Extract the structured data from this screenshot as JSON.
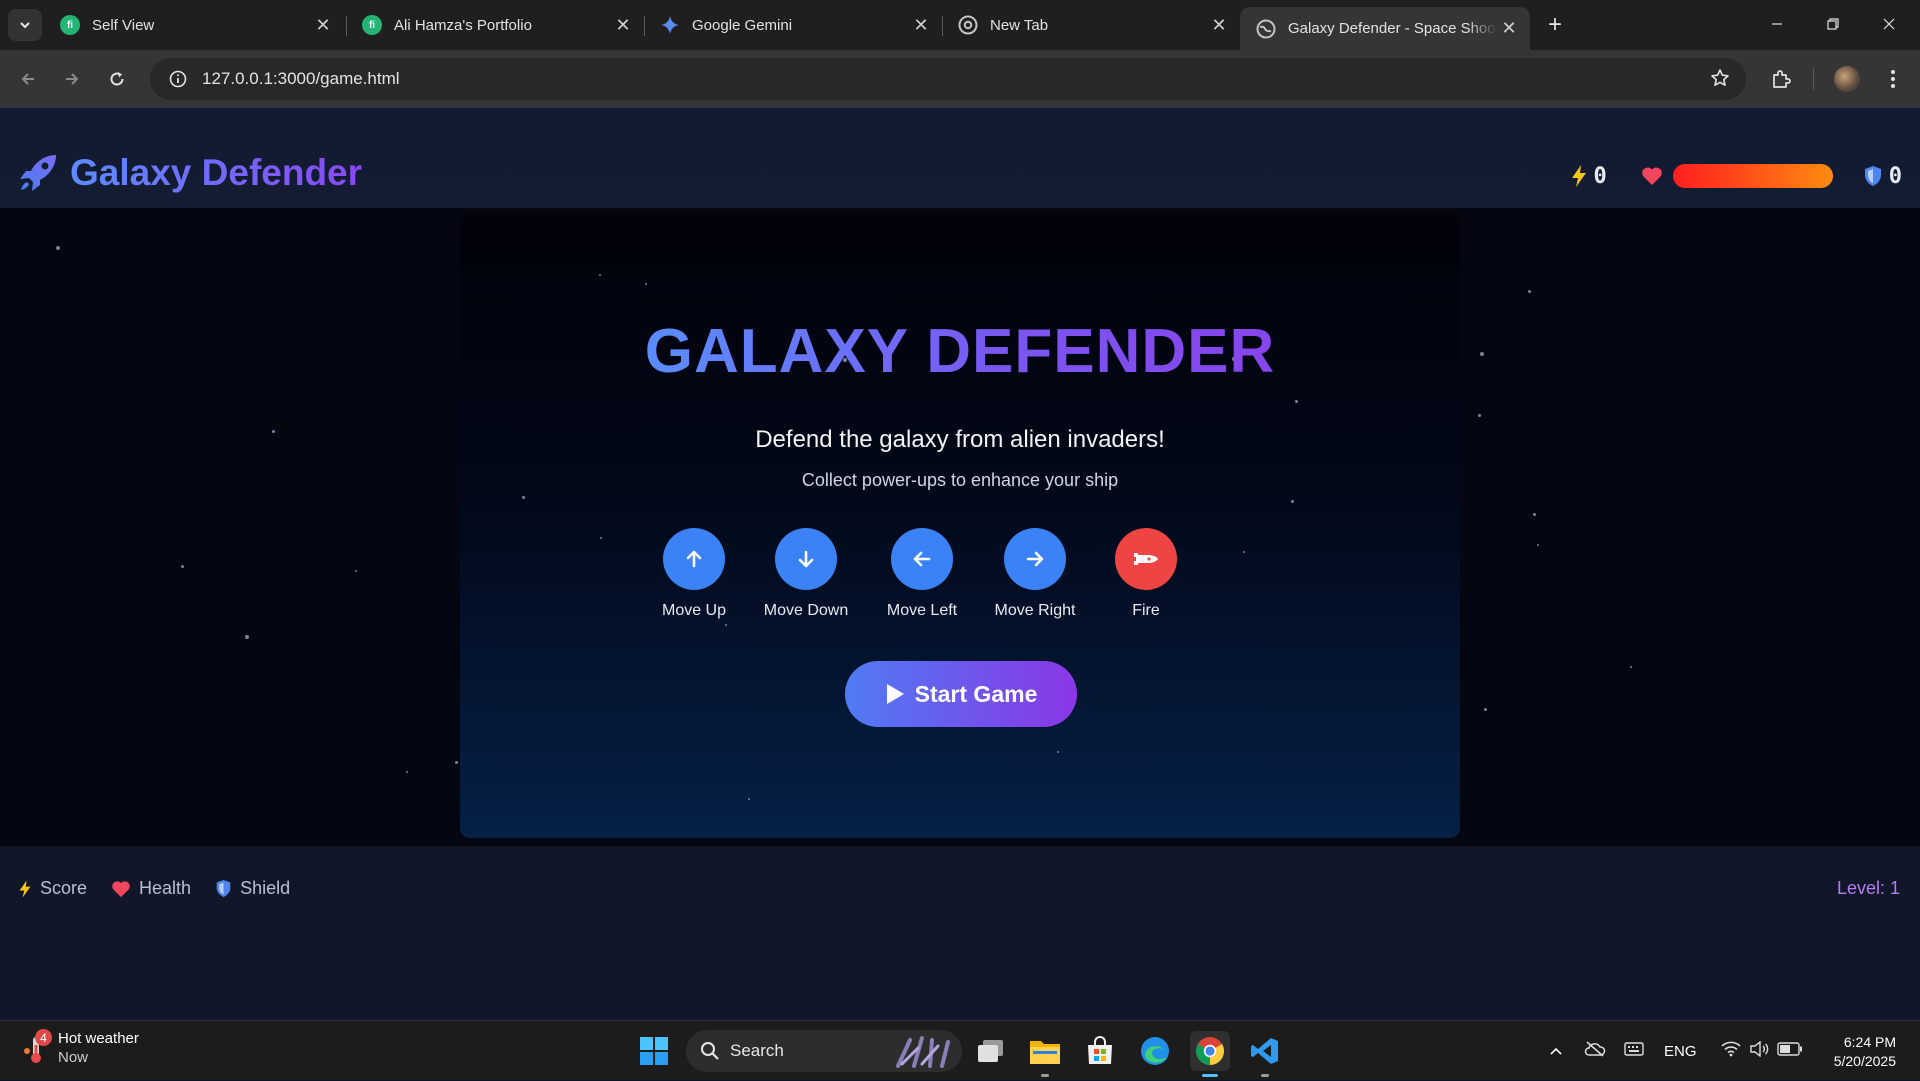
{
  "browser": {
    "tabs": [
      {
        "label": "Self View",
        "active": false
      },
      {
        "label": "Ali Hamza's Portfolio",
        "active": false
      },
      {
        "label": "Google Gemini",
        "active": false
      },
      {
        "label": "New Tab",
        "active": false
      },
      {
        "label": "Galaxy Defender - Space Shooter",
        "active": true
      }
    ],
    "url": "127.0.0.1:3000/game.html"
  },
  "header": {
    "title": "Galaxy Defender",
    "score": "0",
    "shield": "0",
    "health_percent": 100
  },
  "game": {
    "title": "GALAXY DEFENDER",
    "subtitle": "Defend the galaxy from alien invaders!",
    "tagline": "Collect power-ups to enhance your ship",
    "controls": [
      {
        "label": "Move Up",
        "icon": "arrow-up-icon"
      },
      {
        "label": "Move Down",
        "icon": "arrow-down-icon"
      },
      {
        "label": "Move Left",
        "icon": "arrow-left-icon"
      },
      {
        "label": "Move Right",
        "icon": "arrow-right-icon"
      },
      {
        "label": "Fire",
        "icon": "fire-icon"
      }
    ],
    "start_label": "Start Game"
  },
  "footer": {
    "legend": [
      "Score",
      "Health",
      "Shield"
    ],
    "level": "Level: 1"
  },
  "taskbar": {
    "weather_title": "Hot weather",
    "weather_sub": "Now",
    "weather_badge": "4",
    "search_placeholder": "Search",
    "lang": "ENG",
    "time": "6:24 PM",
    "date": "5/20/2025"
  },
  "colors": {
    "accent_blue": "#3b82f6",
    "accent_purple": "#8b36e6",
    "fire_red": "#ef4444",
    "level_purple": "#b57cf7"
  }
}
